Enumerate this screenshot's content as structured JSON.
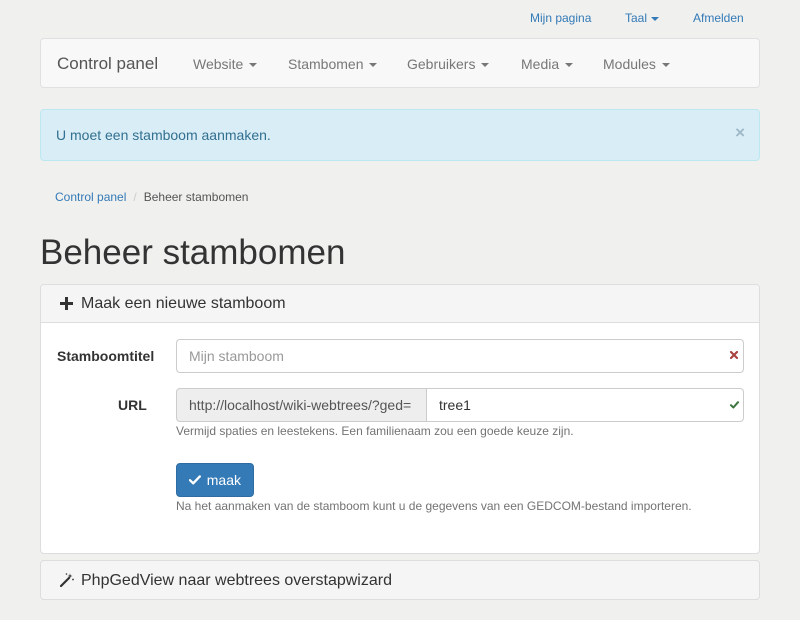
{
  "top_menu": {
    "my_page": "Mijn pagina",
    "language": "Taal",
    "logout": "Afmelden"
  },
  "navbar": {
    "brand": "Control panel",
    "items": [
      "Website",
      "Stambomen",
      "Gebruikers",
      "Media",
      "Modules"
    ]
  },
  "alert": {
    "message": "U moet een stamboom aanmaken.",
    "close": "×"
  },
  "breadcrumb": {
    "root": "Control panel",
    "current": "Beheer stambomen"
  },
  "page_title": "Beheer stambomen",
  "new_tree_panel": {
    "heading": "Maak een nieuwe stamboom",
    "title_label": "Stamboomtitel",
    "title_placeholder": "Mijn stamboom",
    "url_label": "URL",
    "url_prefix": "http://localhost/wiki-webtrees/?ged=",
    "url_value": "tree1",
    "url_help": "Vermijd spaties en leestekens. Een familienaam zou een goede keuze zijn.",
    "create_button": "maak",
    "create_help": "Na het aanmaken van de stamboom kunt u de gegevens van een GEDCOM-bestand importeren."
  },
  "wizard_panel": {
    "heading": "PhpGedView naar webtrees overstapwizard"
  },
  "colors": {
    "link": "#337ab7",
    "alert_bg": "#d9edf7",
    "primary": "#337ab7",
    "invalid": "#a94442",
    "valid": "#3c763d"
  },
  "icons": [
    "caret-down-icon",
    "close-icon",
    "plus-icon",
    "invalid-x-icon",
    "valid-check-icon",
    "check-icon",
    "magic-wand-icon"
  ]
}
